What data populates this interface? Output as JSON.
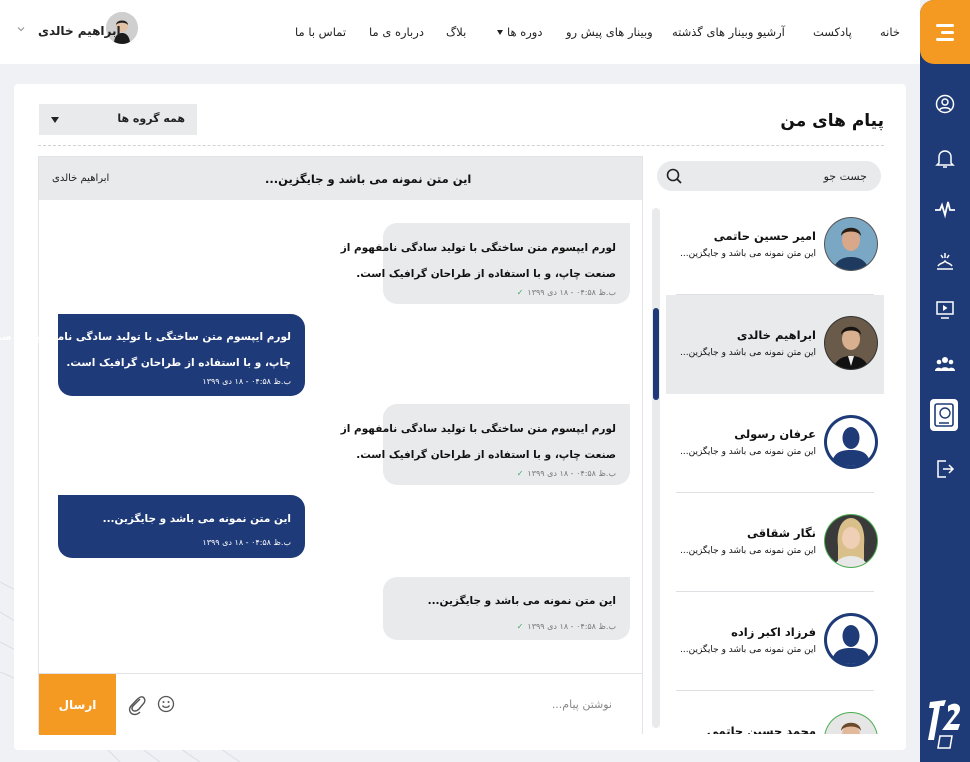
{
  "nav": {
    "items": [
      {
        "id": "home",
        "label": "خانه"
      },
      {
        "id": "podcast",
        "label": "پادکست"
      },
      {
        "id": "webinar-archive",
        "label": "آرشیو وبینار های گذشته"
      },
      {
        "id": "upcoming-webinars",
        "label": "وبینار های پیش رو"
      },
      {
        "id": "courses",
        "label": "دوره ها",
        "dropdown": true
      },
      {
        "id": "blog",
        "label": "بلاگ"
      },
      {
        "id": "about",
        "label": "درباره ی ما"
      },
      {
        "id": "contact",
        "label": "تماس با ما"
      }
    ],
    "user_name": "ابراهیم خالدی"
  },
  "sidebar": {
    "icons": [
      "menu-icon",
      "user-icon",
      "bell-icon",
      "activity-icon",
      "certificate-icon",
      "video-icon",
      "group-icon",
      "messages-icon",
      "logout-icon",
      "brand-logo"
    ],
    "active": "messages-icon",
    "accent_color": "#f49a23",
    "bg_color": "#1f3b77"
  },
  "page": {
    "title": "پیام های من",
    "group_filter": "همه گروه ها"
  },
  "contacts": {
    "search_placeholder": "جست جو",
    "items": [
      {
        "name": "امیر حسین حاتمی",
        "preview": "این متن نمونه می باشد و جایگزین...",
        "avatar": "photo"
      },
      {
        "name": "ابراهیم خالدی",
        "preview": "این متن نمونه می باشد و جایگزین...",
        "avatar": "photo",
        "selected": true
      },
      {
        "name": "عرفان رسولی",
        "preview": "این متن نمونه می باشد و جایگزین...",
        "avatar": "placeholder"
      },
      {
        "name": "نگار شقاقی",
        "preview": "این متن نمونه می باشد و جایگزین...",
        "avatar": "photo"
      },
      {
        "name": "فرزاد اکبر زاده",
        "preview": "این متن نمونه می باشد و جایگزین...",
        "avatar": "placeholder"
      },
      {
        "name": "محمد حسین حاتمی",
        "preview": "",
        "avatar": "photo"
      }
    ]
  },
  "chat": {
    "subject": "این متن نمونه می باشد و جایگزین...",
    "contact_name": "ابراهیم خالدی",
    "messages": [
      {
        "dir": "incoming",
        "lines": [
          "لورم ایپسوم متن ساختگی با تولید سادگی نامفهوم از",
          "صنعت چاپ، و با استفاده از طراحان گرافیک است."
        ],
        "meta": "ب.ظ ۰۴:۵۸ - ۱۸ دی ۱۳۹۹"
      },
      {
        "dir": "outgoing",
        "lines": [
          "لورم ایپسوم متن ساختگی با تولید سادگی نامفهوم از صنعت",
          "چاپ، و با استفاده از طراحان گرافیک است."
        ],
        "meta": "ب.ظ ۰۴:۵۸ - ۱۸ دی ۱۳۹۹"
      },
      {
        "dir": "incoming",
        "lines": [
          "لورم ایپسوم متن ساختگی با تولید سادگی نامفهوم از",
          "صنعت چاپ، و با استفاده از طراحان گرافیک است."
        ],
        "meta": "ب.ظ ۰۴:۵۸ - ۱۸ دی ۱۳۹۹"
      },
      {
        "dir": "outgoing",
        "lines": [
          "این متن نمونه می باشد و جایگزین..."
        ],
        "meta": "ب.ظ ۰۴:۵۸ - ۱۸ دی ۱۳۹۹"
      },
      {
        "dir": "incoming",
        "lines": [
          "این متن نمونه می باشد و جایگزین..."
        ],
        "meta": "ب.ظ ۰۴:۵۸ - ۱۸ دی ۱۳۹۹"
      }
    ],
    "input_placeholder": "نوشتن پیام...",
    "send_label": "ارسال"
  }
}
